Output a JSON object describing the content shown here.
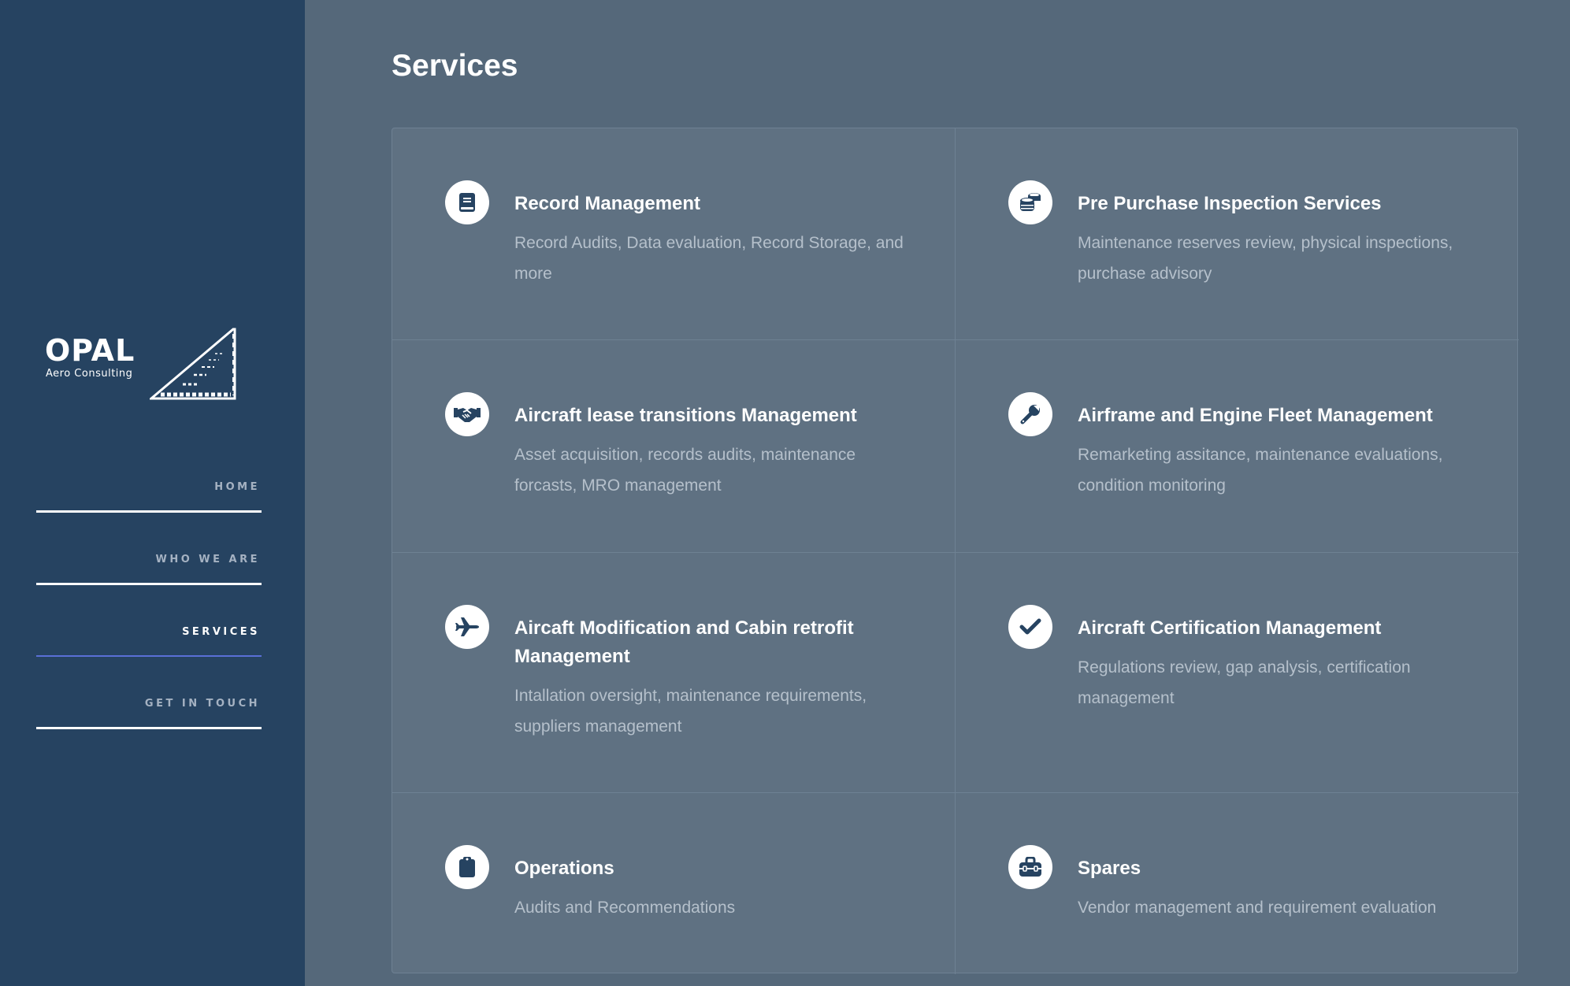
{
  "brand": {
    "name": "OPAL",
    "tagline": "Aero Consulting"
  },
  "nav": {
    "items": [
      {
        "label": "HOME",
        "active": false
      },
      {
        "label": "WHO WE ARE",
        "active": false
      },
      {
        "label": "SERVICES",
        "active": true
      },
      {
        "label": "GET IN TOUCH",
        "active": false
      }
    ]
  },
  "main": {
    "title": "Services",
    "services": [
      {
        "icon": "book-icon",
        "title": "Record Management",
        "description": "Record Audits, Data evaluation, Record Storage, and more"
      },
      {
        "icon": "coins-icon",
        "title": "Pre Purchase Inspection Services",
        "description": "Maintenance reserves review, physical inspections, purchase advisory"
      },
      {
        "icon": "handshake-icon",
        "title": "Aircraft lease transitions Management",
        "description": "Asset acquisition, records audits, maintenance forcasts, MRO management"
      },
      {
        "icon": "wrench-icon",
        "title": "Airframe and Engine Fleet Management",
        "description": "Remarketing assitance, maintenance evaluations, condition monitoring"
      },
      {
        "icon": "plane-icon",
        "title": "Aircaft Modification and Cabin retrofit Management",
        "description": "Intallation oversight, maintenance requirements, suppliers management"
      },
      {
        "icon": "check-icon",
        "title": "Aircraft Certification Management",
        "description": "Regulations review, gap analysis, certification management"
      },
      {
        "icon": "clipboard-icon",
        "title": "Operations",
        "description": "Audits and Recommendations"
      },
      {
        "icon": "toolbox-icon",
        "title": "Spares",
        "description": "Vendor management and requirement evaluation"
      }
    ]
  },
  "colors": {
    "sidebar": "#264361",
    "main_bg": "#55687a",
    "card_bg": "#5f7182",
    "icon_fg": "#264361",
    "active_underline": "#5a6fd6"
  }
}
